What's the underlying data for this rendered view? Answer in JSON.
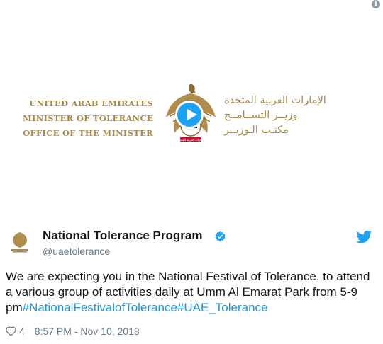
{
  "media": {
    "brand_en": [
      "UNITED ARAB EMIRATES",
      "MINISTER OF TOLERANCE",
      "OFFICE OF THE MINISTER"
    ],
    "brand_ar": [
      "الإمارات العربية المتحدة",
      "وزيــر التســامــح",
      "مكتـب الـوزيــر"
    ],
    "emblem_caption": "الإمارات العربية المتحدة"
  },
  "tweet": {
    "author_name": "National Tolerance Program",
    "handle": "@uaetolerance",
    "text_plain": "We are expecting you in the National Festival of Tolerance, to attend a various group of activities daily at Umm Al Emarat Park from 5-9  pm",
    "hashtags": [
      "#NationalFestivalofTolerance",
      "#UAE_Tolerance"
    ],
    "like_count": "4",
    "timestamp": "8:57 PM - Nov 10, 2018"
  },
  "icons": {
    "info": "info-icon",
    "play": "play-icon",
    "verified": "verified-badge-icon",
    "bird": "twitter-bird-icon",
    "heart": "heart-icon"
  },
  "colors": {
    "brand_gold": "#a98a4a",
    "link": "#1b95e0",
    "twitter_blue": "#1da1f2",
    "muted": "#657786"
  }
}
